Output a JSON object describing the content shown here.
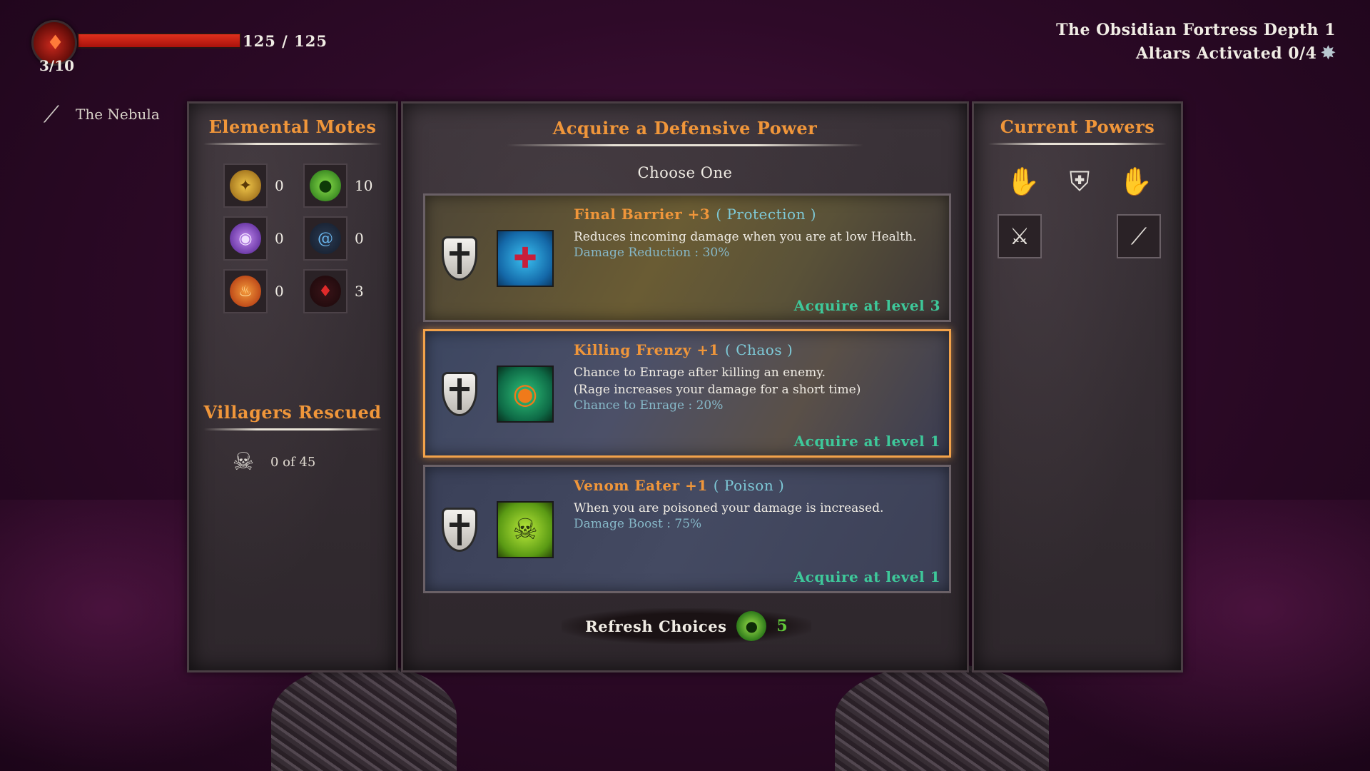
{
  "hud": {
    "health_current_max": "125 / 125",
    "health_fraction": 1.0,
    "flask_count": "3/10",
    "weapon_name": "The Nebula",
    "weapon_icon": "twin-spears-icon",
    "location_line": "The Obsidian Fortress Depth 1",
    "altars_line": "Altars Activated 0/4",
    "altar_icon": "altar-crystal-icon"
  },
  "motes": {
    "title": "Elemental Motes",
    "items": [
      {
        "icon": "gold-mote-icon",
        "value": "0",
        "color": "#d8a22a"
      },
      {
        "icon": "green-mote-icon",
        "value": "10",
        "color": "#4ab83a"
      },
      {
        "icon": "purple-mote-icon",
        "value": "0",
        "color": "#8a4ad8"
      },
      {
        "icon": "blue-spiral-mote-icon",
        "value": "0",
        "color": "#4a9ad8"
      },
      {
        "icon": "fire-mote-icon",
        "value": "0",
        "color": "#e0581c"
      },
      {
        "icon": "blood-mote-icon",
        "value": "3",
        "color": "#c8202a"
      }
    ]
  },
  "villagers": {
    "title": "Villagers Rescued",
    "text": "0 of 45",
    "icon": "villager-skull-icon"
  },
  "choice": {
    "title": "Acquire a Defensive Power",
    "subtitle": "Choose One",
    "cards": [
      {
        "name": "Final Barrier +3",
        "tag": "( Protection )",
        "desc": [
          "Reduces incoming damage when you are at low Health."
        ],
        "stat": "Damage Reduction : 30%",
        "acquire": "Acquire at level 3",
        "icon": "blue-shield-cross-icon"
      },
      {
        "name": "Killing Frenzy +1",
        "tag": "( Chaos )",
        "desc": [
          "Chance to Enrage after killing an enemy.",
          "(Rage increases your damage for a short time)"
        ],
        "stat": "Chance to Enrage : 20%",
        "acquire": "Acquire at level 1",
        "icon": "green-eye-icon",
        "selected": true
      },
      {
        "name": "Venom Eater +1",
        "tag": "( Poison )",
        "desc": [
          "When you are poisoned your damage is increased."
        ],
        "stat": "Damage Boost : 75%",
        "acquire": "Acquire at level 1",
        "icon": "green-skull-icon"
      }
    ],
    "refresh_label": "Refresh Choices",
    "refresh_count": "5"
  },
  "current_powers": {
    "title": "Current Powers",
    "slots": [
      "claw-hand-icon",
      "defense-shield-icon",
      "claw-hand-icon",
      "slash-power-icon",
      "twin-spears-icon"
    ]
  },
  "colors": {
    "accent_orange": "#f0963a",
    "acquire_green": "#3ec89a",
    "stat_blue": "#86b8c8",
    "selected_border": "#f2a24a"
  }
}
